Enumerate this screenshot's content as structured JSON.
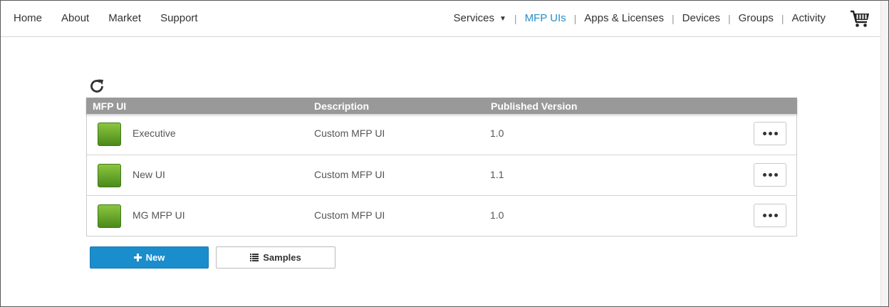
{
  "nav": {
    "left": [
      "Home",
      "About",
      "Market",
      "Support"
    ],
    "services": "Services",
    "right": [
      "MFP UIs",
      "Apps & Licenses",
      "Devices",
      "Groups",
      "Activity"
    ],
    "active": "MFP UIs",
    "cart_icon": "cart-icon"
  },
  "table": {
    "headers": {
      "name": "MFP UI",
      "description": "Description",
      "version": "Published Version"
    },
    "rows": [
      {
        "name": "Executive",
        "description": "Custom MFP UI",
        "version": "1.0"
      },
      {
        "name": "New UI",
        "description": "Custom MFP UI",
        "version": "1.1"
      },
      {
        "name": "MG MFP UI",
        "description": "Custom MFP UI",
        "version": "1.0"
      }
    ]
  },
  "actions": {
    "new_label": "New",
    "samples_label": "Samples"
  },
  "colors": {
    "accent": "#1a8dcd",
    "active_link": "#2a8dc5",
    "header_bg": "#999999",
    "app_icon": "#6aa82a"
  }
}
